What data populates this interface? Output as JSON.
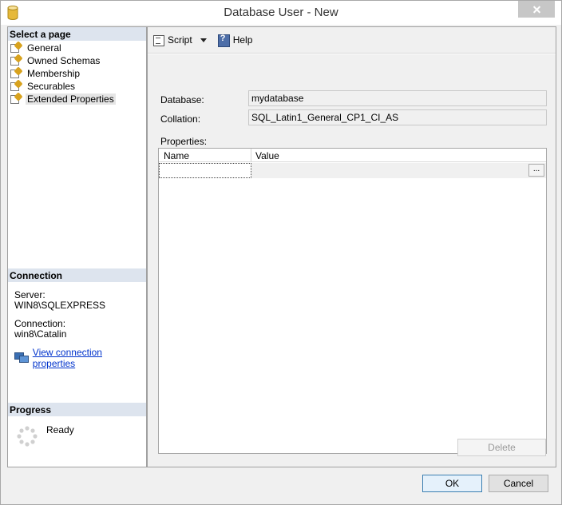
{
  "window": {
    "title": "Database User - New",
    "icon": "database-cylinder-icon"
  },
  "left": {
    "select_page_header": "Select a page",
    "pages": [
      {
        "label": "General",
        "icon": "page-wrench-icon",
        "selected": false
      },
      {
        "label": "Owned Schemas",
        "icon": "page-wrench-icon",
        "selected": false
      },
      {
        "label": "Membership",
        "icon": "page-wrench-icon",
        "selected": false
      },
      {
        "label": "Securables",
        "icon": "page-wrench-icon",
        "selected": false
      },
      {
        "label": "Extended Properties",
        "icon": "page-wrench-icon",
        "selected": true
      }
    ],
    "connection_header": "Connection",
    "server_label": "Server:",
    "server_value": "WIN8\\SQLEXPRESS",
    "connection_label": "Connection:",
    "connection_value": "win8\\Catalin",
    "view_link": "View connection properties",
    "progress_header": "Progress",
    "progress_status": "Ready"
  },
  "toolbar": {
    "script_label": "Script",
    "help_label": "Help"
  },
  "form": {
    "database_label": "Database:",
    "database_value": "mydatabase",
    "collation_label": "Collation:",
    "collation_value": "SQL_Latin1_General_CP1_CI_AS",
    "properties_label": "Properties:",
    "columns": [
      "Name",
      "Value"
    ],
    "ellipsis": "...",
    "delete_label": "Delete"
  },
  "buttons": {
    "ok": "OK",
    "cancel": "Cancel"
  },
  "colors": {
    "section_header": "#dde4ee",
    "link": "#0033cc",
    "ok_border": "#3c7fb1"
  }
}
